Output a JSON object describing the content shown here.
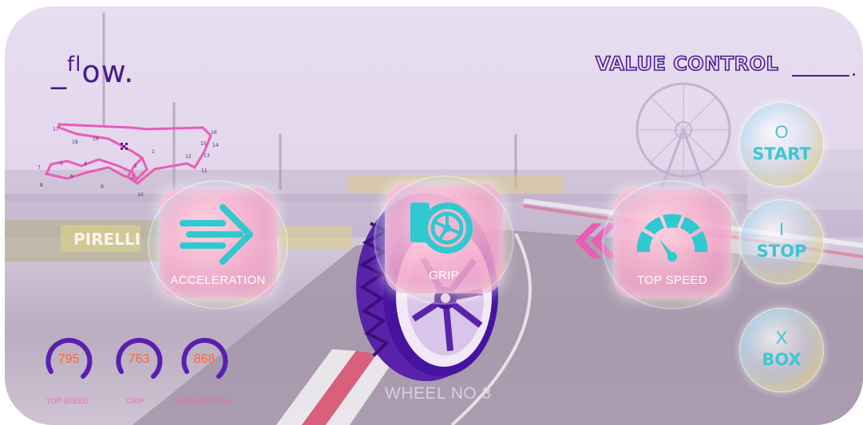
{
  "app": {
    "logo": {
      "prefix": "_",
      "sup": "fl",
      "rest": "ow."
    },
    "title": "VALUE CONTROL"
  },
  "track": {
    "corner_numbers": [
      "1",
      "2",
      "3",
      "4",
      "5",
      "6",
      "7",
      "8",
      "9",
      "10",
      "11",
      "12",
      "13",
      "14",
      "15",
      "16",
      "17",
      "18",
      "19"
    ]
  },
  "features": [
    {
      "label": "ACCELERATION",
      "icon": "arrow-right-icon"
    },
    {
      "label": "GRIP",
      "icon": "wheel-icon"
    },
    {
      "label": "TOP SPEED",
      "icon": "speedometer-icon"
    }
  ],
  "controls": [
    {
      "symbol": "O",
      "label": "START",
      "icon": "circle-icon"
    },
    {
      "symbol": "I",
      "label": "STOP",
      "icon": "bar-icon"
    },
    {
      "symbol": "X",
      "label": "BOX",
      "icon": "x-icon"
    }
  ],
  "stats": [
    {
      "value": "795",
      "label": "TOP SPEED"
    },
    {
      "value": "763",
      "label": "GRIP"
    },
    {
      "value": "868",
      "label": "ACCELERATION"
    }
  ],
  "wheel": {
    "label": "WHEEL NO 3"
  },
  "background": {
    "banner_text": "PIRELLI"
  },
  "colors": {
    "accent": "#4b1e93",
    "cyan": "#3ec6d0",
    "orange": "#ff6a2b",
    "pink": "#f4a6c8"
  }
}
